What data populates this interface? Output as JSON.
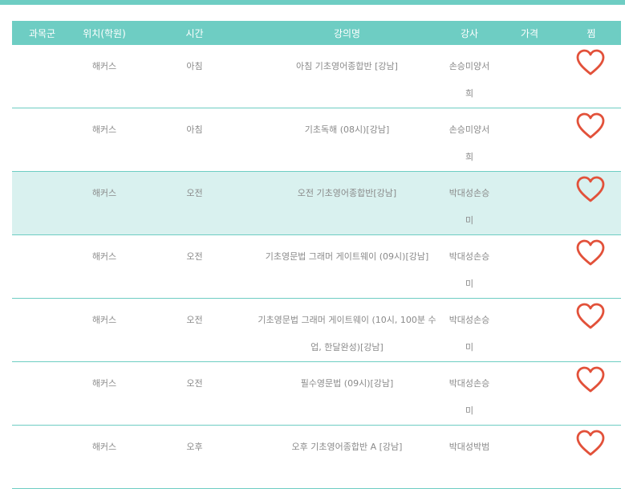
{
  "header": {
    "category": "과목군",
    "location": "위치(학원)",
    "time": "시간",
    "course": "강의명",
    "teacher": "강사",
    "price": "가격",
    "wish": "찜"
  },
  "colors": {
    "accent": "#6ecdc3",
    "highlight_row": "#d9f1ef",
    "heart": "#e2513a"
  },
  "rows": [
    {
      "category": "",
      "location": "해커스",
      "time": "아침",
      "course": "아침 기초영어종합반 [강남]",
      "teacher": "손승미양서희",
      "price": "",
      "wish_icon": "heart-outline-icon"
    },
    {
      "category": "",
      "location": "해커스",
      "time": "아침",
      "course": "기초독해 (08시)[강남]",
      "teacher": "손승미양서희",
      "price": "",
      "wish_icon": "heart-outline-icon"
    },
    {
      "category": "",
      "location": "해커스",
      "time": "오전",
      "course": "오전 기초영어종합반[강남]",
      "teacher": "박대성손승미",
      "price": "",
      "wish_icon": "heart-outline-icon",
      "highlighted": true
    },
    {
      "category": "",
      "location": "해커스",
      "time": "오전",
      "course": "기초영문법 그래머 게이트웨이 (09시)[강남]",
      "teacher": "박대성손승미",
      "price": "",
      "wish_icon": "heart-outline-icon"
    },
    {
      "category": "",
      "location": "해커스",
      "time": "오전",
      "course": "기초영문법 그래머 게이트웨이 (10시, 100분 수업, 한달완성)[강남]",
      "teacher": "박대성손승미",
      "price": "",
      "wish_icon": "heart-outline-icon"
    },
    {
      "category": "",
      "location": "해커스",
      "time": "오전",
      "course": "필수영문법 (09시)[강남]",
      "teacher": "박대성손승미",
      "price": "",
      "wish_icon": "heart-outline-icon"
    },
    {
      "category": "",
      "location": "해커스",
      "time": "오후",
      "course": "오후 기초영어종합반 A [강남]",
      "teacher": "박대성박범",
      "price": "",
      "wish_icon": "heart-outline-icon"
    }
  ]
}
